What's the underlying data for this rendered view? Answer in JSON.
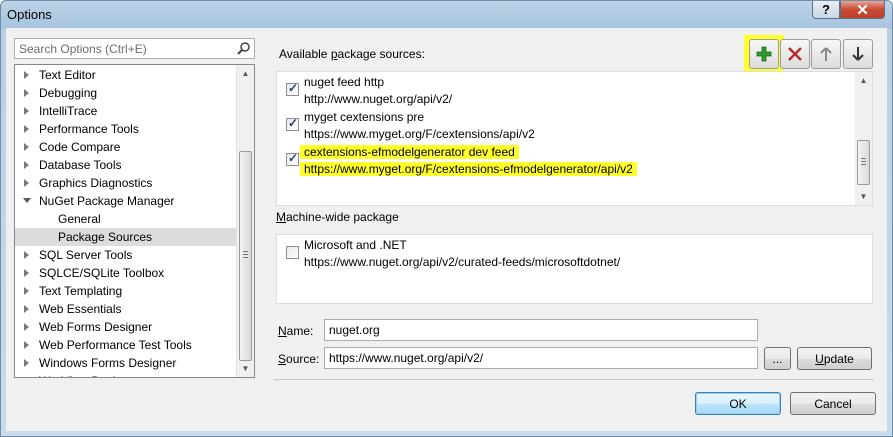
{
  "window": {
    "title": "Options",
    "help_label": "?",
    "close_label": "✕"
  },
  "search": {
    "placeholder": "Search Options (Ctrl+E)"
  },
  "tree": {
    "items": [
      {
        "label": "Text Editor",
        "level": 0,
        "state": "collapsed"
      },
      {
        "label": "Debugging",
        "level": 0,
        "state": "collapsed"
      },
      {
        "label": "IntelliTrace",
        "level": 0,
        "state": "collapsed"
      },
      {
        "label": "Performance Tools",
        "level": 0,
        "state": "collapsed"
      },
      {
        "label": "Code Compare",
        "level": 0,
        "state": "collapsed"
      },
      {
        "label": "Database Tools",
        "level": 0,
        "state": "collapsed"
      },
      {
        "label": "Graphics Diagnostics",
        "level": 0,
        "state": "collapsed"
      },
      {
        "label": "NuGet Package Manager",
        "level": 0,
        "state": "expanded"
      },
      {
        "label": "General",
        "level": 1,
        "state": "leaf"
      },
      {
        "label": "Package Sources",
        "level": 1,
        "state": "selected"
      },
      {
        "label": "SQL Server Tools",
        "level": 0,
        "state": "collapsed"
      },
      {
        "label": "SQLCE/SQLite Toolbox",
        "level": 0,
        "state": "collapsed"
      },
      {
        "label": "Text Templating",
        "level": 0,
        "state": "collapsed"
      },
      {
        "label": "Web Essentials",
        "level": 0,
        "state": "collapsed"
      },
      {
        "label": "Web Forms Designer",
        "level": 0,
        "state": "collapsed"
      },
      {
        "label": "Web Performance Test Tools",
        "level": 0,
        "state": "collapsed"
      },
      {
        "label": "Windows Forms Designer",
        "level": 0,
        "state": "collapsed"
      },
      {
        "label": "Workflow Designer",
        "level": 0,
        "state": "collapsed"
      }
    ]
  },
  "sources": {
    "heading_pre": "Available ",
    "heading_key": "p",
    "heading_post": "ackage sources:",
    "items": [
      {
        "name": "nuget feed http",
        "url": "http://www.nuget.org/api/v2/",
        "checked": true,
        "highlighted": false
      },
      {
        "name": "myget cextensions pre",
        "url": "https://www.myget.org/F/cextensions/api/v2",
        "checked": true,
        "highlighted": false
      },
      {
        "name": "cextensions-efmodelgenerator dev feed",
        "url": "https://www.myget.org/F/cextensions-efmodelgenerator/api/v2",
        "checked": true,
        "highlighted": true
      }
    ]
  },
  "toolbar": {
    "add_icon": "plus-icon",
    "remove_icon": "x-icon",
    "up_icon": "arrow-up-icon",
    "down_icon": "arrow-down-icon",
    "add_color": "#2e9a2e",
    "remove_color": "#b32d2d"
  },
  "machine": {
    "heading_key": "M",
    "heading_post": "achine-wide package",
    "items": [
      {
        "name": "Microsoft and .NET",
        "url": "https://www.nuget.org/api/v2/curated-feeds/microsoftdotnet/",
        "checked": false
      }
    ]
  },
  "form": {
    "name_key": "N",
    "name_post": "ame:",
    "name_value": "nuget.org",
    "source_key": "S",
    "source_post": "ource:",
    "source_value": "https://www.nuget.org/api/v2/",
    "browse_label": "...",
    "update_key": "U",
    "update_post": "pdate"
  },
  "buttons": {
    "ok": "OK",
    "cancel": "Cancel"
  },
  "colors": {
    "highlight": "#ffff2a",
    "selected_row": "#dcdcdc"
  }
}
